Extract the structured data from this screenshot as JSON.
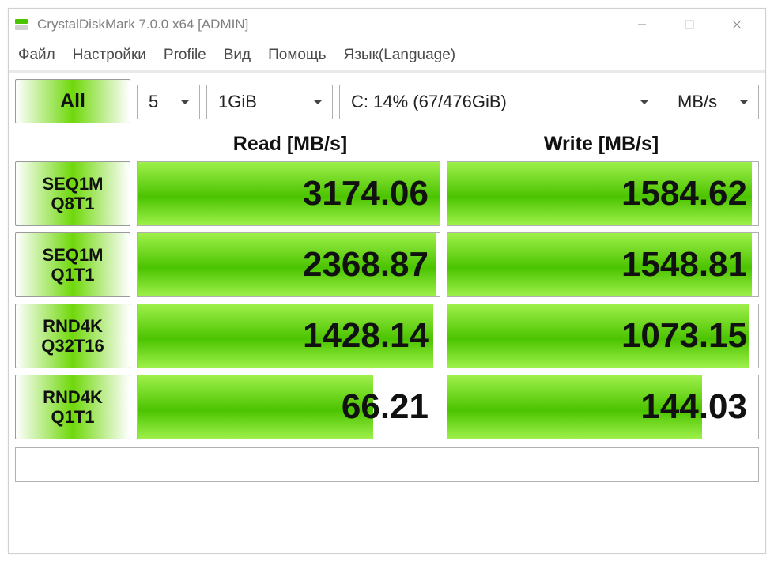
{
  "window": {
    "title": "CrystalDiskMark 7.0.0 x64 [ADMIN]"
  },
  "menu": {
    "items": [
      "Файл",
      "Настройки",
      "Profile",
      "Вид",
      "Помощь",
      "Язык(Language)"
    ]
  },
  "toolbar": {
    "all_label": "All",
    "count": "5",
    "size": "1GiB",
    "drive": "C: 14% (67/476GiB)",
    "unit": "MB/s"
  },
  "headers": {
    "read": "Read [MB/s]",
    "write": "Write [MB/s]"
  },
  "tests": [
    {
      "line1": "SEQ1M",
      "line2": "Q8T1",
      "read": "3174.06",
      "read_fill": 100,
      "write": "1584.62",
      "write_fill": 98
    },
    {
      "line1": "SEQ1M",
      "line2": "Q1T1",
      "read": "2368.87",
      "read_fill": 99,
      "write": "1548.81",
      "write_fill": 98
    },
    {
      "line1": "RND4K",
      "line2": "Q32T16",
      "read": "1428.14",
      "read_fill": 98,
      "write": "1073.15",
      "write_fill": 97
    },
    {
      "line1": "RND4K",
      "line2": "Q1T1",
      "read": "66.21",
      "read_fill": 78,
      "write": "144.03",
      "write_fill": 82
    }
  ],
  "colors": {
    "accent": "#4bc400"
  }
}
